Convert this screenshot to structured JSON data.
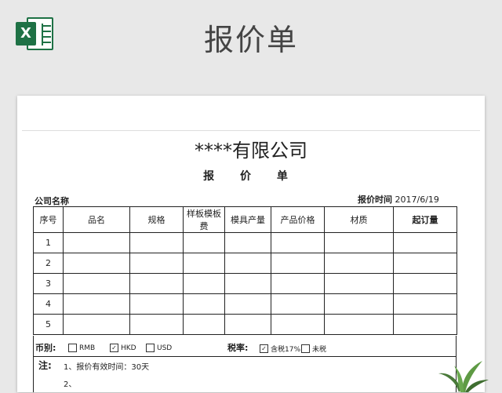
{
  "header": {
    "app_icon_letter": "X",
    "title": "报价单"
  },
  "sheet": {
    "company": "****有限公司",
    "doc_title": "报 价 单",
    "company_label": "公司名称",
    "date_label": "报价时间",
    "date_value": "2017/6/19",
    "columns": [
      "序号",
      "品名",
      "规格",
      "样板模板费",
      "模具产量",
      "产品价格",
      "材质",
      "起订量"
    ],
    "row_numbers": [
      "1",
      "2",
      "3",
      "4",
      "5"
    ],
    "currency": {
      "label": "币别:",
      "options": [
        {
          "label": "RMB",
          "checked": false
        },
        {
          "label": "HKD",
          "checked": true
        },
        {
          "label": "USD",
          "checked": false
        }
      ]
    },
    "tax": {
      "label": "税率:",
      "options": [
        {
          "label": "含税17%",
          "checked": true
        },
        {
          "label": "未税",
          "checked": false
        }
      ]
    },
    "notes": {
      "label": "注:",
      "items": [
        "1、报价有效时间：30天",
        "2、"
      ]
    }
  },
  "colors": {
    "excel_green": "#1e7145",
    "background": "#e8e8e8"
  }
}
